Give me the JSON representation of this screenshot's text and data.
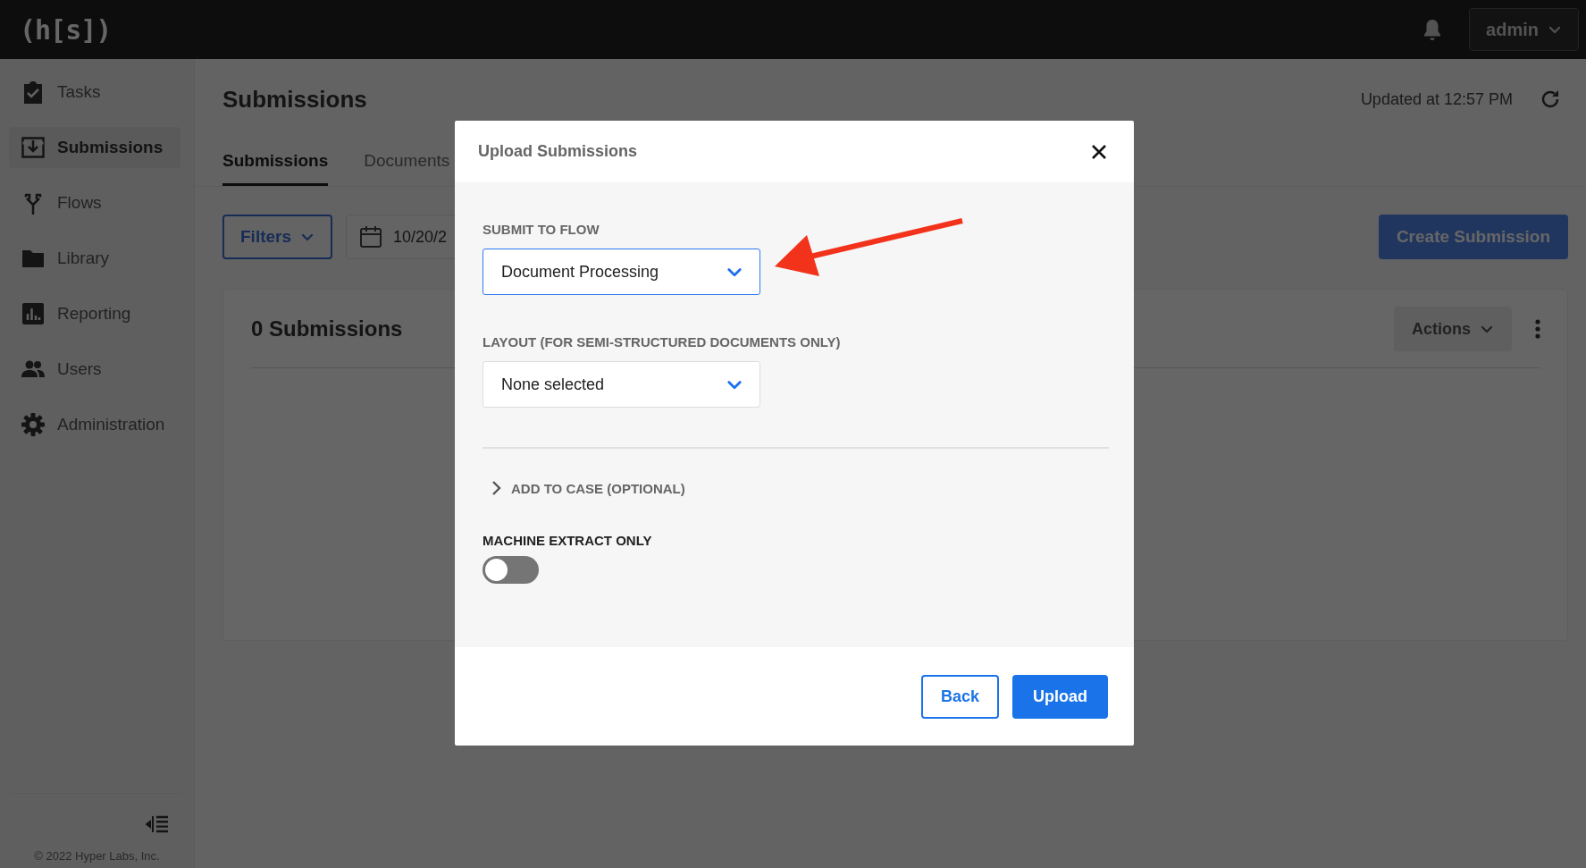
{
  "topbar": {
    "logo": "(h[s])",
    "user_menu": "admin"
  },
  "sidebar": {
    "items": [
      {
        "label": "Tasks",
        "selected": false
      },
      {
        "label": "Submissions",
        "selected": true
      },
      {
        "label": "Flows",
        "selected": false
      },
      {
        "label": "Library",
        "selected": false
      },
      {
        "label": "Reporting",
        "selected": false
      },
      {
        "label": "Users",
        "selected": false
      },
      {
        "label": "Administration",
        "selected": false
      }
    ],
    "copyright": "© 2022 Hyper Labs, Inc."
  },
  "page": {
    "title": "Submissions",
    "updated": "Updated at 12:57 PM",
    "tabs": [
      {
        "label": "Submissions",
        "selected": true
      },
      {
        "label": "Documents",
        "selected": false
      }
    ],
    "filters_button": "Filters",
    "date_field": "10/20/2",
    "create_button": "Create Submission",
    "card": {
      "title": "0 Submissions",
      "actions_button": "Actions"
    }
  },
  "modal": {
    "title": "Upload Submissions",
    "fields": [
      {
        "label": "SUBMIT TO FLOW",
        "value": "Document Processing",
        "focused": true
      },
      {
        "label": "LAYOUT (FOR SEMI-STRUCTURED DOCUMENTS ONLY)",
        "value": "None selected",
        "focused": false
      }
    ],
    "add_to_case": {
      "label": "ADD TO CASE (OPTIONAL)",
      "expanded": false
    },
    "machine_extract": {
      "label": "MACHINE EXTRACT ONLY",
      "on": false
    },
    "buttons": [
      {
        "label": "Back",
        "kind": "secondary"
      },
      {
        "label": "Upload",
        "kind": "primary"
      }
    ]
  }
}
